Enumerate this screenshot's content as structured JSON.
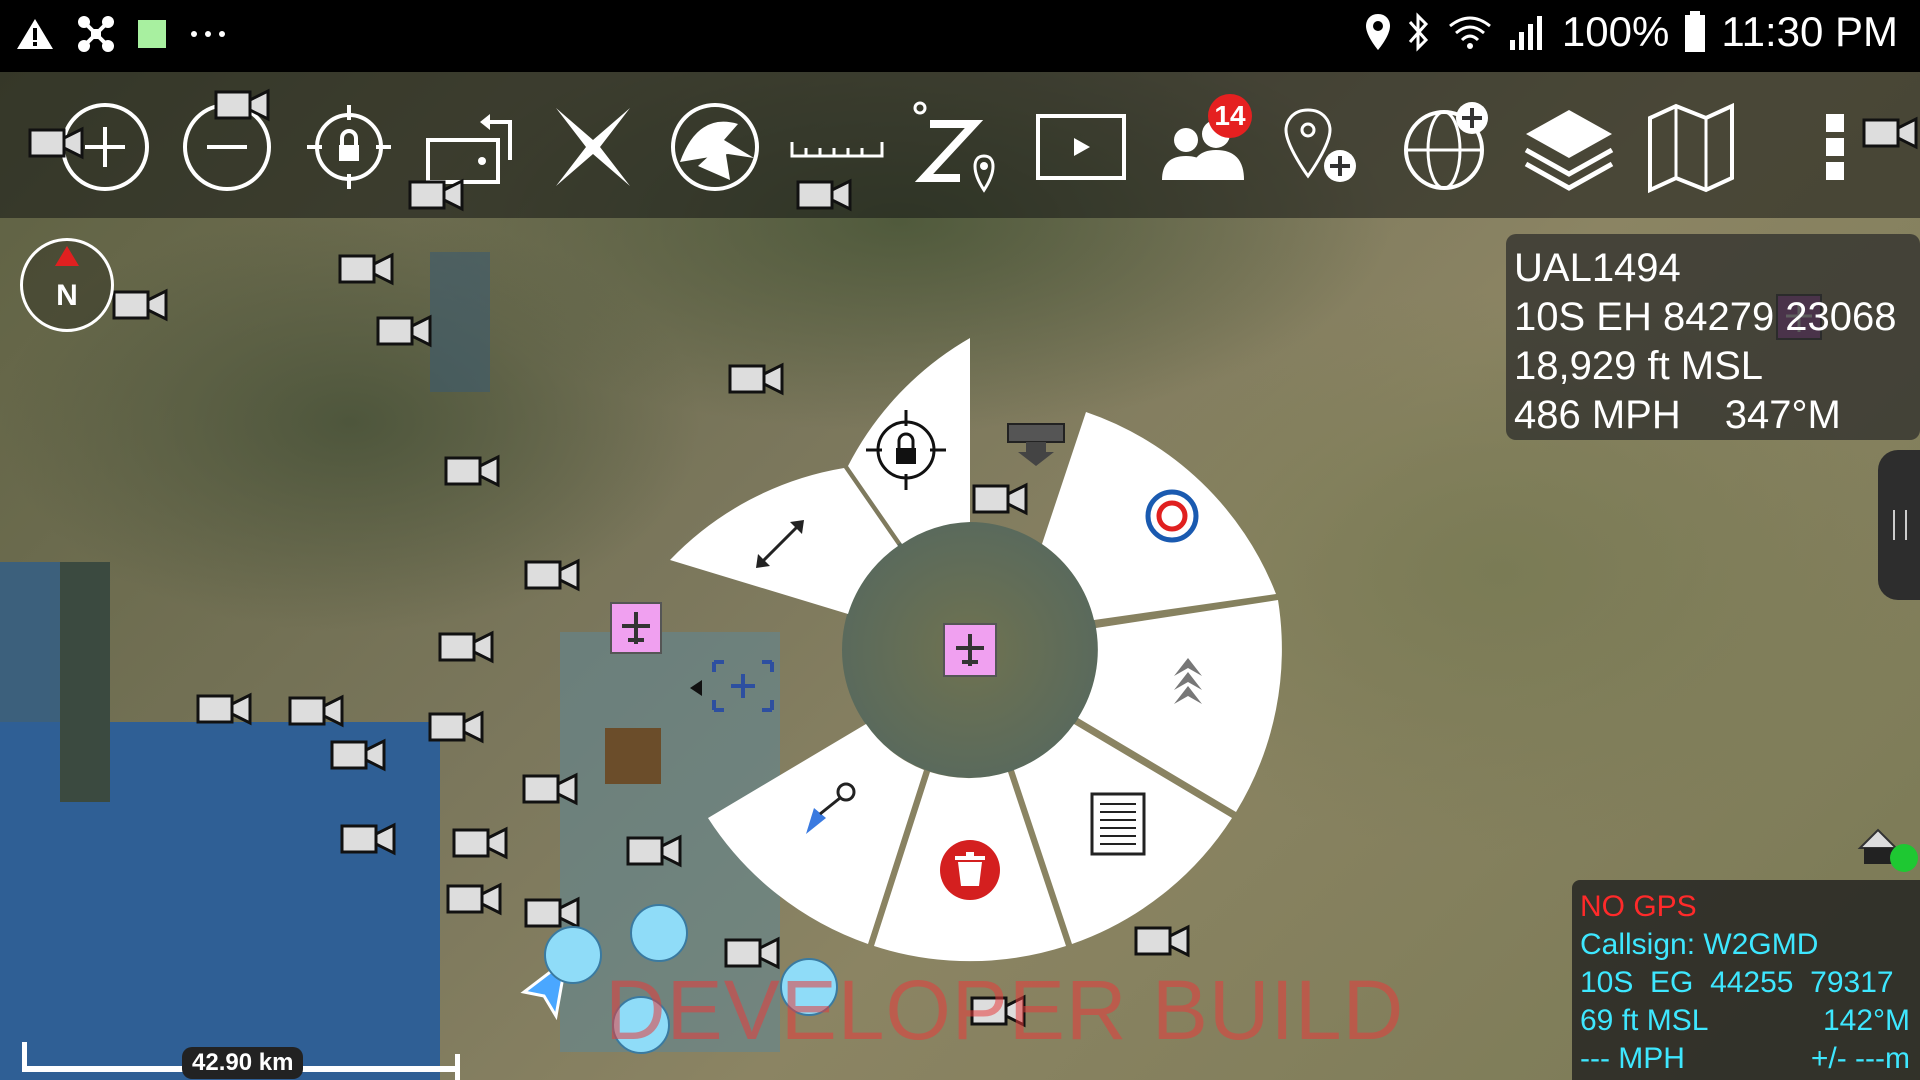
{
  "status_bar": {
    "left_icons": [
      "warning-icon",
      "drone-icon",
      "green-square-icon",
      "more-dots-icon"
    ],
    "right_icons": [
      "location-icon",
      "bluetooth-icon",
      "wifi-icon",
      "signal-icon",
      "battery-icon"
    ],
    "battery": "100%",
    "time": "11:30 PM"
  },
  "toolbar": {
    "items": [
      {
        "name": "zoom-in-icon"
      },
      {
        "name": "zoom-out-icon"
      },
      {
        "name": "lock-target-icon"
      },
      {
        "name": "rotate-screen-icon"
      },
      {
        "name": "close-x-icon"
      },
      {
        "name": "cone-icon"
      },
      {
        "name": "ruler-icon"
      },
      {
        "name": "route-z-icon"
      },
      {
        "name": "video-player-icon"
      },
      {
        "name": "contacts-icon",
        "badge": "14"
      },
      {
        "name": "add-point-icon"
      },
      {
        "name": "add-globe-icon"
      },
      {
        "name": "layers-icon"
      },
      {
        "name": "map-icon"
      },
      {
        "name": "overflow-menu-icon"
      }
    ]
  },
  "compass": {
    "label": "N"
  },
  "target_info": {
    "callsign": "UAL1494",
    "grid": "10S EH 84279 23068",
    "altitude": "18,929 ft MSL",
    "speed": "486 MPH",
    "heading": "347°M"
  },
  "self_info": {
    "gps": "NO GPS",
    "callsign_label": "Callsign: W2GMD",
    "grid": "10S  EG  44255  79317",
    "altitude": "69 ft MSL",
    "heading": "142°M",
    "speed": "--- MPH",
    "accuracy": "+/- ---m"
  },
  "watermark": "DEVELOPER BUILD",
  "scale_bar": {
    "label": "42.90 km"
  },
  "radial_menu": {
    "items": [
      "lock-icon",
      "expand-arrows-icon",
      "target-circle-icon",
      "chevrons-up-icon",
      "details-doc-icon",
      "delete-icon",
      "route-pointer-icon"
    ]
  }
}
